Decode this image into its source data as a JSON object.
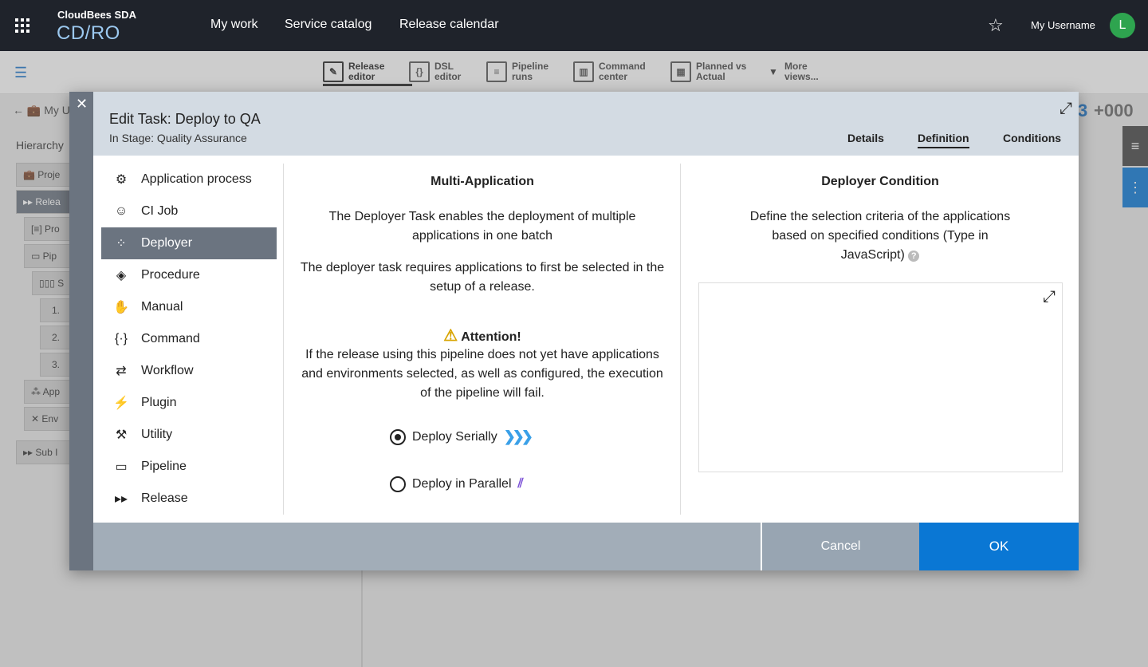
{
  "topbar": {
    "brand_top": "CloudBees SDA",
    "brand_main": "CD/RO",
    "nav": [
      "My work",
      "Service catalog",
      "Release calendar"
    ],
    "username": "My Username",
    "avatar_initial": "L"
  },
  "views": [
    {
      "label": "Release editor",
      "icon": "edit-icon"
    },
    {
      "label": "DSL editor",
      "icon": "braces-icon"
    },
    {
      "label": "Pipeline runs",
      "icon": "list-icon"
    },
    {
      "label": "Command center",
      "icon": "bar-chart-icon"
    },
    {
      "label": "Planned vs Actual",
      "icon": "grid-icon"
    },
    {
      "label": "More views...",
      "icon": "caret-down-icon"
    }
  ],
  "background": {
    "back_label": "My U",
    "hierarchy_title": "Hierarchy",
    "rows": [
      "Proje",
      "Relea",
      "Pro",
      "Pip",
      "S",
      "1.",
      "2.",
      "3.",
      "App",
      "Env",
      "Sub I"
    ],
    "score_left": "3",
    "score_right": "+000"
  },
  "modal": {
    "title": "Edit Task: Deploy to QA",
    "subtitle": "In Stage: Quality Assurance",
    "tabs": [
      "Details",
      "Definition",
      "Conditions"
    ],
    "active_tab": "Definition",
    "task_types": [
      "Application process",
      "CI Job",
      "Deployer",
      "Procedure",
      "Manual",
      "Command",
      "Workflow",
      "Plugin",
      "Utility",
      "Pipeline",
      "Release"
    ],
    "selected_task": "Deployer",
    "middle": {
      "heading": "Multi-Application",
      "p1": "The Deployer Task enables the deployment of multiple applications in one batch",
      "p2": "The deployer task requires applications to first be selected in the setup of a release.",
      "attention": "Attention!",
      "p3": "If the release using this pipeline does not yet have applications and environments selected, as well as configured, the execution of the pipeline will fail.",
      "radio_serial": "Deploy Serially",
      "radio_parallel": "Deploy in Parallel",
      "selected_mode": "Deploy Serially"
    },
    "right": {
      "heading": "Deployer Condition",
      "desc": "Define the selection criteria of the applications based on specified conditions (Type in JavaScript)",
      "code_value": ""
    },
    "footer": {
      "cancel": "Cancel",
      "ok": "OK"
    }
  },
  "colors": {
    "accent": "#0a77d4",
    "topbar": "#1f232b",
    "selected": "#6b7480",
    "avatar": "#2ea44f"
  }
}
